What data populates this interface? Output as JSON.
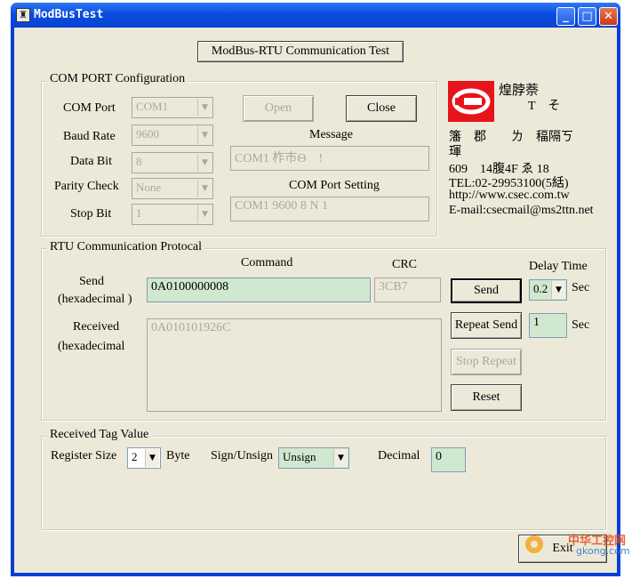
{
  "window": {
    "title": "ModBusTest",
    "minimize": "_",
    "maximize": "□",
    "close": "✕"
  },
  "header_button": "ModBus-RTU Communication Test",
  "com_port": {
    "group_label": "COM PORT Configuration",
    "port_label": "COM Port",
    "port_value": "COM1",
    "baud_label": "Baud Rate",
    "baud_value": "9600",
    "databit_label": "Data Bit",
    "databit_value": "8",
    "parity_label": "Parity Check",
    "parity_value": "None",
    "stopbit_label": "Stop Bit",
    "stopbit_value": "1",
    "open_label": "Open",
    "close_label": "Close",
    "message_label": "Message",
    "message_value": "COM1 柞巿Θ　!",
    "setting_label": "COM Port Setting",
    "setting_value": "COM1 9600 8 N 1"
  },
  "company": {
    "name": "煌脖萘",
    "name_line2": "T　そ",
    "line3": "籓　郡　　ㄌ　稫隔ㄎ",
    "line4": "琿",
    "address": "609　14腹4F ゑ 18",
    "tel": "TEL:02-29953100(5絬)",
    "url": "http://www.csec.com.tw",
    "email": "E-mail:csecmail@ms2ttn.net",
    "logo_color": "#e8141b"
  },
  "rtu": {
    "group_label": "RTU Communication Protocal",
    "command_label": "Command",
    "crc_label": "CRC",
    "delay_label": "Delay Time",
    "send_label": "Send",
    "send_sub": "(hexadecimal )",
    "command_value": "0A0100000008",
    "crc_value": "3CB7",
    "received_label": "Received",
    "received_sub": "(hexadecimal",
    "received_value": "0A010101926C",
    "send_button": "Send",
    "repeat_button": "Repeat Send",
    "stop_button": "Stop Repeat",
    "reset_button": "Reset",
    "delay_value": "0.2",
    "delay_unit": "Sec",
    "repeat_value": "1",
    "repeat_unit": "Sec"
  },
  "tag": {
    "group_label": "Received Tag Value",
    "register_label": "Register Size",
    "register_value": "2",
    "byte_label": "Byte",
    "sign_label": "Sign/Unsign",
    "sign_value": "Unsign",
    "decimal_label": "Decimal",
    "decimal_value": "0"
  },
  "exit_button": "Exit",
  "watermark": {
    "cn": "中华工控网",
    "en": "gkong.com"
  }
}
